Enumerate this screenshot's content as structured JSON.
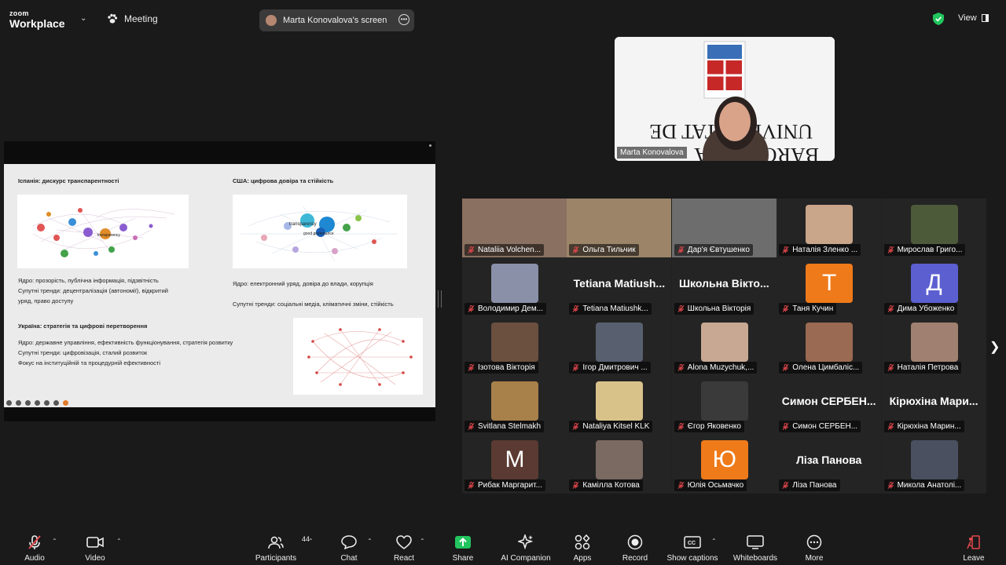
{
  "app": {
    "brand_top": "zoom",
    "brand_bottom": "Workplace",
    "meeting_label": "Meeting"
  },
  "screen_share": {
    "owner_label": "Marta Konovalova's screen"
  },
  "view_label": "View",
  "slide": {
    "spain_heading": "Іспанія: дискурс транспарентності",
    "spain_lines": [
      "Ядро: прозорість, публічна інформація, підзвітність",
      "Супутні тренди: децентралізація (автономії), відкритий",
      "уряд, право доступу"
    ],
    "usa_heading": "США: цифрова довіра та стійкість",
    "usa_core": "Ядро: електронний уряд, довіра до влади, корупція",
    "usa_trends": "Супутні тренди: соціальні медіа, кліматичні зміни, стійкість",
    "ukraine_heading": "Україна: стратегія та цифрові перетворення",
    "ukraine_lines": [
      "Ядро: державне управління, ефективність функціонування, стратегія розвитку",
      "Супутні тренди: цифровізація, сталий розвиток",
      "Фокус на інституційній та процедурній ефективності"
    ],
    "net_label_1": "transparency",
    "net_label_2": "e-government",
    "net_label_3": "good governance"
  },
  "active_speaker": {
    "name": "Marta Konovalova"
  },
  "participants": [
    {
      "name": "Nataliia Volchen...",
      "kind": "video",
      "color": "#8a7060"
    },
    {
      "name": "Ольга Тильчик",
      "kind": "video",
      "color": "#9b8468"
    },
    {
      "name": "Дар'я Євтушенко",
      "kind": "video",
      "color": "#6d6d6d"
    },
    {
      "name": "Наталія Зленко ...",
      "kind": "photo",
      "color": "#c9a58a"
    },
    {
      "name": "Мирослав Григо...",
      "kind": "photo",
      "color": "#4d5a3a"
    },
    {
      "name": "Володимир Дем...",
      "kind": "photo",
      "color": "#8a90a8"
    },
    {
      "name": "Tetiana Matiushk...",
      "kind": "text",
      "big": "Tetiana Matiush..."
    },
    {
      "name": "Школьна Вікторія",
      "kind": "text",
      "big": "Школьна Вікто..."
    },
    {
      "name": "Таня Кучин",
      "kind": "letter",
      "letter": "Т",
      "color": "#ef7a1a"
    },
    {
      "name": "Дима Убоженко",
      "kind": "letter",
      "letter": "Д",
      "color": "#5b5fd0"
    },
    {
      "name": "Ізотова Вікторія",
      "kind": "photo",
      "color": "#6b5040"
    },
    {
      "name": "Ігор Дмитрович ...",
      "kind": "photo",
      "color": "#586070"
    },
    {
      "name": "Alona Muzychuk,...",
      "kind": "photo",
      "color": "#c8a892"
    },
    {
      "name": "Олена Цимбаліс...",
      "kind": "photo",
      "color": "#9a6a52"
    },
    {
      "name": "Наталія Петрова",
      "kind": "photo",
      "color": "#a08070"
    },
    {
      "name": "Svitlana Stelmakh",
      "kind": "photo",
      "color": "#a8804a"
    },
    {
      "name": "Nataliya Kitsel KLK",
      "kind": "photo",
      "color": "#d8c28a"
    },
    {
      "name": "Єгор Яковенко",
      "kind": "photo",
      "color": "#3a3a3a"
    },
    {
      "name": "Симон СЕРБЕН...",
      "kind": "text",
      "big": "Симон СЕРБЕН..."
    },
    {
      "name": "Кірюхіна Марин...",
      "kind": "text",
      "big": "Кірюхіна Мари..."
    },
    {
      "name": "Рибак Маргарит...",
      "kind": "letter",
      "letter": "М",
      "color": "#5a3a32"
    },
    {
      "name": "Камілла Котова",
      "kind": "photo",
      "color": "#7a6a62"
    },
    {
      "name": "Юлія Осьмачко",
      "kind": "letter",
      "letter": "Ю",
      "color": "#ef7a1a"
    },
    {
      "name": "Ліза Панова",
      "kind": "text",
      "big": "Ліза Панова"
    },
    {
      "name": "Микола Анатолі...",
      "kind": "photo",
      "color": "#4a5060"
    }
  ],
  "toolbar": {
    "audio": "Audio",
    "video": "Video",
    "participants": "Participants",
    "participants_count": "44",
    "chat": "Chat",
    "react": "React",
    "share": "Share",
    "ai": "AI Companion",
    "apps": "Apps",
    "record": "Record",
    "captions": "Show captions",
    "whiteboards": "Whiteboards",
    "more": "More",
    "leave": "Leave"
  },
  "colors": {
    "share_green": "#22c55e",
    "mic_red": "#e5484d",
    "leave_red": "#e5484d"
  }
}
